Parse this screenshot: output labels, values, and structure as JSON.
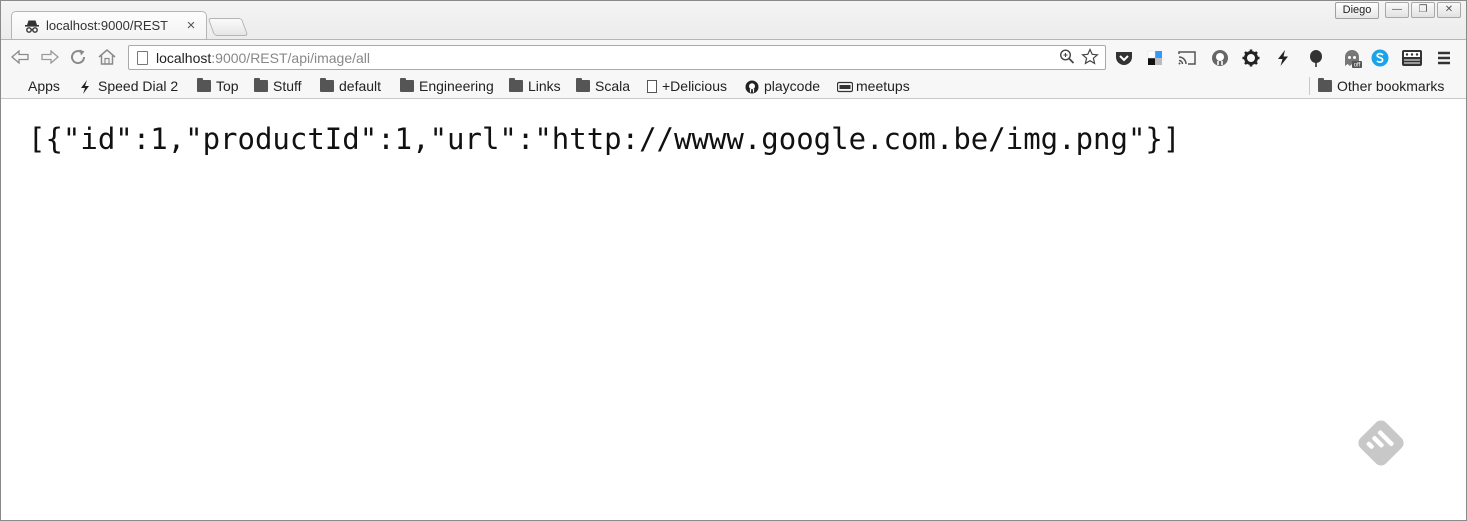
{
  "tab": {
    "title": "localhost:9000/REST",
    "close_glyph": "×",
    "icon": "incognito-icon"
  },
  "window": {
    "profile_name": "Diego",
    "minimize_glyph": "—",
    "maximize_glyph": "❐",
    "close_glyph": "✕"
  },
  "toolbar": {
    "url_host": "localhost",
    "url_path": ":9000/REST/api/image/all",
    "icons": [
      "back-icon",
      "forward-icon",
      "reload-icon",
      "home-icon",
      "zoom-icon",
      "star-icon",
      "pocket-icon",
      "delicious-icon",
      "cast-icon",
      "github-icon",
      "gear-icon",
      "speed-icon",
      "feather-icon",
      "ghostery-icon",
      "skype-icon",
      "extension-icon",
      "menu-icon"
    ]
  },
  "bookmarks": {
    "items": [
      {
        "label": "Apps",
        "icon": "apps-icon"
      },
      {
        "label": "Speed Dial 2",
        "icon": "bolt-icon"
      },
      {
        "label": "Top",
        "icon": "folder-icon"
      },
      {
        "label": "Stuff",
        "icon": "folder-icon"
      },
      {
        "label": "default",
        "icon": "folder-icon"
      },
      {
        "label": "Engineering",
        "icon": "folder-icon"
      },
      {
        "label": "Links",
        "icon": "folder-icon"
      },
      {
        "label": "Scala",
        "icon": "folder-icon"
      },
      {
        "label": "+Delicious",
        "icon": "document-icon"
      },
      {
        "label": "playcode",
        "icon": "github-icon"
      },
      {
        "label": "meetups",
        "icon": "meetup-icon"
      }
    ],
    "other": {
      "label": "Other bookmarks",
      "icon": "folder-icon"
    }
  },
  "page": {
    "body_text": "[{\"id\":1,\"productId\":1,\"url\":\"http://wwww.google.com.be/img.png\"}]"
  },
  "colors": {
    "chrome_bg": "#f7f7f7",
    "url_path": "#888888",
    "feedly_gray": "#c8c8c8",
    "skype_blue": "#1aa3e8"
  }
}
